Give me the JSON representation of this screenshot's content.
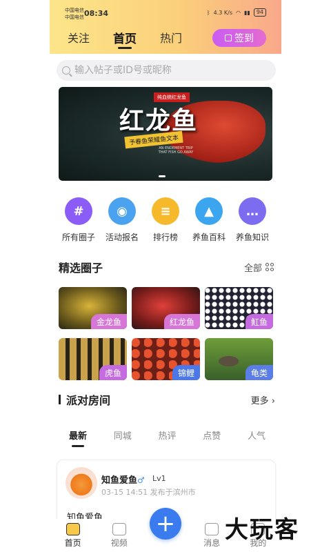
{
  "status": {
    "carrier1": "中国电信",
    "carrier2": "中国电信",
    "time": "08:34",
    "net_speed": "4.3 K/s",
    "battery": "94"
  },
  "header": {
    "tabs": [
      "关注",
      "首页",
      "热门"
    ],
    "signin_label": "签到"
  },
  "search": {
    "placeholder": "输入帖子或ID号或昵称"
  },
  "banner": {
    "tag": "纯血统红龙鱼",
    "title": "红龙鱼",
    "subtitle": "予春鱼荣耀鱼文本",
    "english": "AN ENDEMENT TRIP THAT FISH GO AWAY"
  },
  "categories": [
    {
      "label": "所有圈子",
      "icon": "hash-icon",
      "color": "#8b5cf6"
    },
    {
      "label": "活动报名",
      "icon": "camera-icon",
      "color": "#4ba3f0"
    },
    {
      "label": "排行榜",
      "icon": "document-icon",
      "color": "#f6b92b"
    },
    {
      "label": "养鱼百科",
      "icon": "graduation-cap-icon",
      "color": "#3ba5ef"
    },
    {
      "label": "养鱼知识",
      "icon": "chat-icon",
      "color": "#7b6cf0"
    }
  ],
  "featured": {
    "title": "精选圈子",
    "all_label": "全部",
    "circles": [
      {
        "label": "金龙鱼",
        "tag_color": "#d676d6"
      },
      {
        "label": "红龙鱼",
        "tag_color": "#d676d6"
      },
      {
        "label": "魟鱼",
        "tag_color": "#c56be0"
      },
      {
        "label": "虎鱼",
        "tag_color": "#c56be0"
      },
      {
        "label": "锦鲤",
        "tag_color": "#4b78e6"
      },
      {
        "label": "龟类",
        "tag_color": "#5b7ee6"
      }
    ]
  },
  "party": {
    "title": "派对房间",
    "more_label": "更多 ›"
  },
  "feed_tabs": [
    "最新",
    "同城",
    "热评",
    "点赞",
    "人气"
  ],
  "post": {
    "username": "知鱼爱鱼",
    "gender": "♂",
    "level": "Lv1",
    "meta": "03-15 14:51 发布于滨州市",
    "text": "知鱼爱鱼"
  },
  "bottom_nav": [
    {
      "label": "首页"
    },
    {
      "label": "视频"
    },
    {
      "label": ""
    },
    {
      "label": "消息"
    },
    {
      "label": "我的"
    }
  ],
  "fab_label": "+",
  "watermark": "大玩客"
}
